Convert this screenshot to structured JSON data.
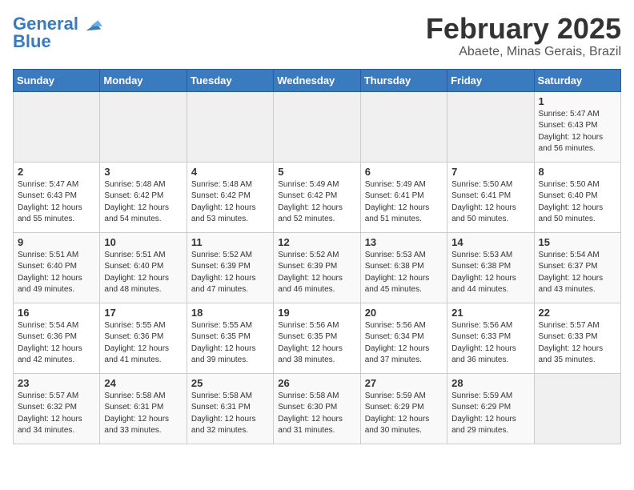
{
  "logo": {
    "line1": "General",
    "line2": "Blue"
  },
  "title": "February 2025",
  "subtitle": "Abaete, Minas Gerais, Brazil",
  "weekdays": [
    "Sunday",
    "Monday",
    "Tuesday",
    "Wednesday",
    "Thursday",
    "Friday",
    "Saturday"
  ],
  "weeks": [
    [
      {
        "day": "",
        "info": ""
      },
      {
        "day": "",
        "info": ""
      },
      {
        "day": "",
        "info": ""
      },
      {
        "day": "",
        "info": ""
      },
      {
        "day": "",
        "info": ""
      },
      {
        "day": "",
        "info": ""
      },
      {
        "day": "1",
        "info": "Sunrise: 5:47 AM\nSunset: 6:43 PM\nDaylight: 12 hours\nand 56 minutes."
      }
    ],
    [
      {
        "day": "2",
        "info": "Sunrise: 5:47 AM\nSunset: 6:43 PM\nDaylight: 12 hours\nand 55 minutes."
      },
      {
        "day": "3",
        "info": "Sunrise: 5:48 AM\nSunset: 6:42 PM\nDaylight: 12 hours\nand 54 minutes."
      },
      {
        "day": "4",
        "info": "Sunrise: 5:48 AM\nSunset: 6:42 PM\nDaylight: 12 hours\nand 53 minutes."
      },
      {
        "day": "5",
        "info": "Sunrise: 5:49 AM\nSunset: 6:42 PM\nDaylight: 12 hours\nand 52 minutes."
      },
      {
        "day": "6",
        "info": "Sunrise: 5:49 AM\nSunset: 6:41 PM\nDaylight: 12 hours\nand 51 minutes."
      },
      {
        "day": "7",
        "info": "Sunrise: 5:50 AM\nSunset: 6:41 PM\nDaylight: 12 hours\nand 50 minutes."
      },
      {
        "day": "8",
        "info": "Sunrise: 5:50 AM\nSunset: 6:40 PM\nDaylight: 12 hours\nand 50 minutes."
      }
    ],
    [
      {
        "day": "9",
        "info": "Sunrise: 5:51 AM\nSunset: 6:40 PM\nDaylight: 12 hours\nand 49 minutes."
      },
      {
        "day": "10",
        "info": "Sunrise: 5:51 AM\nSunset: 6:40 PM\nDaylight: 12 hours\nand 48 minutes."
      },
      {
        "day": "11",
        "info": "Sunrise: 5:52 AM\nSunset: 6:39 PM\nDaylight: 12 hours\nand 47 minutes."
      },
      {
        "day": "12",
        "info": "Sunrise: 5:52 AM\nSunset: 6:39 PM\nDaylight: 12 hours\nand 46 minutes."
      },
      {
        "day": "13",
        "info": "Sunrise: 5:53 AM\nSunset: 6:38 PM\nDaylight: 12 hours\nand 45 minutes."
      },
      {
        "day": "14",
        "info": "Sunrise: 5:53 AM\nSunset: 6:38 PM\nDaylight: 12 hours\nand 44 minutes."
      },
      {
        "day": "15",
        "info": "Sunrise: 5:54 AM\nSunset: 6:37 PM\nDaylight: 12 hours\nand 43 minutes."
      }
    ],
    [
      {
        "day": "16",
        "info": "Sunrise: 5:54 AM\nSunset: 6:36 PM\nDaylight: 12 hours\nand 42 minutes."
      },
      {
        "day": "17",
        "info": "Sunrise: 5:55 AM\nSunset: 6:36 PM\nDaylight: 12 hours\nand 41 minutes."
      },
      {
        "day": "18",
        "info": "Sunrise: 5:55 AM\nSunset: 6:35 PM\nDaylight: 12 hours\nand 39 minutes."
      },
      {
        "day": "19",
        "info": "Sunrise: 5:56 AM\nSunset: 6:35 PM\nDaylight: 12 hours\nand 38 minutes."
      },
      {
        "day": "20",
        "info": "Sunrise: 5:56 AM\nSunset: 6:34 PM\nDaylight: 12 hours\nand 37 minutes."
      },
      {
        "day": "21",
        "info": "Sunrise: 5:56 AM\nSunset: 6:33 PM\nDaylight: 12 hours\nand 36 minutes."
      },
      {
        "day": "22",
        "info": "Sunrise: 5:57 AM\nSunset: 6:33 PM\nDaylight: 12 hours\nand 35 minutes."
      }
    ],
    [
      {
        "day": "23",
        "info": "Sunrise: 5:57 AM\nSunset: 6:32 PM\nDaylight: 12 hours\nand 34 minutes."
      },
      {
        "day": "24",
        "info": "Sunrise: 5:58 AM\nSunset: 6:31 PM\nDaylight: 12 hours\nand 33 minutes."
      },
      {
        "day": "25",
        "info": "Sunrise: 5:58 AM\nSunset: 6:31 PM\nDaylight: 12 hours\nand 32 minutes."
      },
      {
        "day": "26",
        "info": "Sunrise: 5:58 AM\nSunset: 6:30 PM\nDaylight: 12 hours\nand 31 minutes."
      },
      {
        "day": "27",
        "info": "Sunrise: 5:59 AM\nSunset: 6:29 PM\nDaylight: 12 hours\nand 30 minutes."
      },
      {
        "day": "28",
        "info": "Sunrise: 5:59 AM\nSunset: 6:29 PM\nDaylight: 12 hours\nand 29 minutes."
      },
      {
        "day": "",
        "info": ""
      }
    ]
  ]
}
